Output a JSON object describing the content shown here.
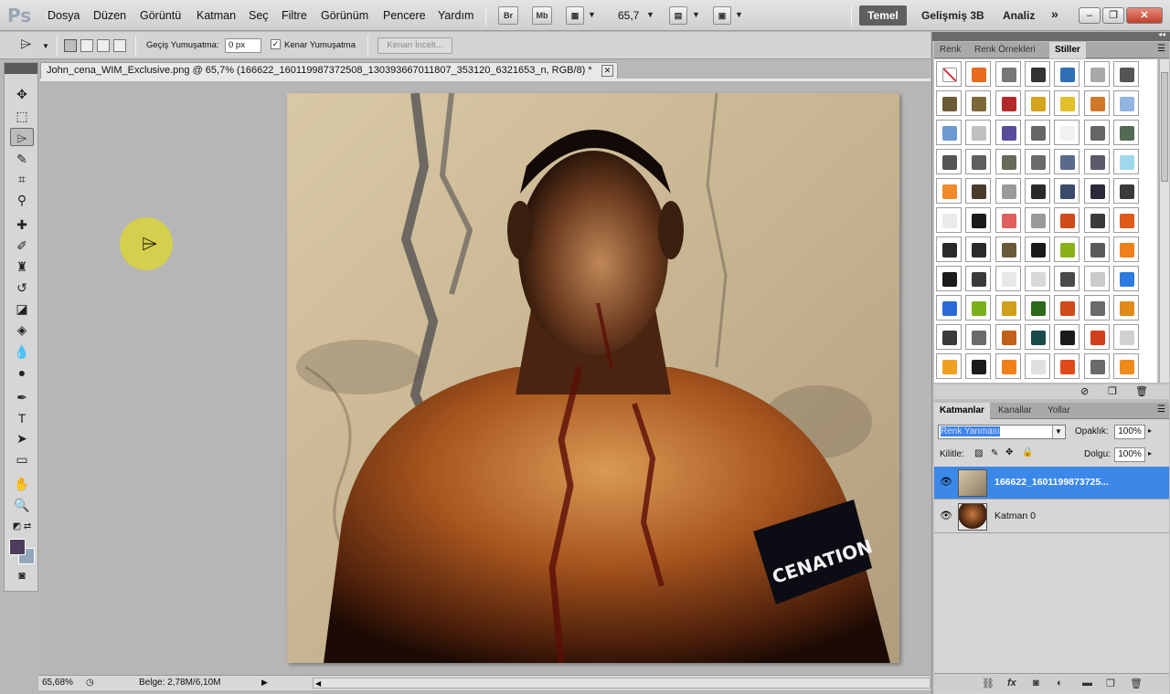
{
  "app": {
    "logo": "Ps",
    "menu": [
      "Dosya",
      "Düzen",
      "Görüntü",
      "Katman",
      "Seç",
      "Filtre",
      "Görünüm",
      "Pencere",
      "Yardım"
    ],
    "bridge_label": "Br",
    "minibridge_label": "Mb",
    "zoom": "65,7",
    "workspaces": {
      "active": "Temel",
      "items": [
        "Gelişmiş 3B",
        "Analiz"
      ],
      "more": "»"
    }
  },
  "options": {
    "feather_label": "Geçiş Yumuşatma:",
    "feather_value": "0 px",
    "antialias_label": "Kenar Yumuşatma",
    "antialias_checked": "✓",
    "refine_edge_label": "Kenarı İncelt..."
  },
  "document": {
    "tab_title": "John_cena_WIM_Exclusive.png @ 65,7% (166622_160119987372508_130393667011807_353120_6321653_n, RGB/8) *",
    "armband_text": "CENATION"
  },
  "status": {
    "zoom": "65,68%",
    "doc_size": "Belge: 2,78M/6,10M"
  },
  "styles_panel": {
    "tabs": [
      "Renk",
      "Renk Örnekleri",
      "Stiller"
    ],
    "active_tab": "Stiller",
    "swatch_colors": [
      "#ffffff",
      "#e86b1e",
      "#777777",
      "#333333",
      "#2f6fb5",
      "#a9a9a9",
      "#555555",
      "#6b5a35",
      "#7a6838",
      "#b22a2a",
      "#d4a51c",
      "#e2c02a",
      "#d0782a",
      "#8fb5e0",
      "#6c9ad0",
      "#c0c0c0",
      "#5a4c9a",
      "#666666",
      "#f1f1f1",
      "#666666",
      "#556a55",
      "#555555",
      "#5e5e5e",
      "#6a6a5a",
      "#6a6a6a",
      "#5a6a8a",
      "#5a5a6a",
      "#9ed8ea",
      "#f08a2a",
      "#4a3a2a",
      "#9a9a9a",
      "#2a2a2a",
      "#3a4a6a",
      "#2a2a3a",
      "#3a3a3a",
      "#eaeaea",
      "#1a1a1a",
      "#e06060",
      "#9a9a9a",
      "#d04a1a",
      "#3a3a3a",
      "#e05a1a",
      "#2a2a2a",
      "#2a2a2a",
      "#6a5a3a",
      "#1a1a1a",
      "#8ab01a",
      "#5a5a5a",
      "#f0801a",
      "#1a1a1a",
      "#3a3a3a",
      "#e8e8e8",
      "#d8d8d8",
      "#4a4a4a",
      "#cacaca",
      "#2a7ae0",
      "#2a6ad8",
      "#7ab01a",
      "#d0a01a",
      "#2a6a1a",
      "#d04a1a",
      "#6a6a6a",
      "#e08a1a",
      "#3a3a3a",
      "#6a6a6a",
      "#c0601a",
      "#1a4a4a",
      "#1a1a1a",
      "#d0401a",
      "#d0d0d0",
      "#f0a020",
      "#1a1a1a",
      "#f0801a",
      "#e0e0e0",
      "#e04a1a",
      "#6a6a6a",
      "#f08a1a"
    ]
  },
  "layers_panel": {
    "tabs": [
      "Katmanlar",
      "Kanallar",
      "Yollar"
    ],
    "active_tab": "Katmanlar",
    "blend_mode": "Renk Yanması",
    "opacity_label": "Opaklık:",
    "opacity_value": "100%",
    "lock_label": "Kilitle:",
    "fill_label": "Dolgu:",
    "fill_value": "100%",
    "layers": [
      {
        "name": "166622_1601199873725...",
        "selected": true
      },
      {
        "name": "Katman 0",
        "selected": false
      }
    ]
  }
}
